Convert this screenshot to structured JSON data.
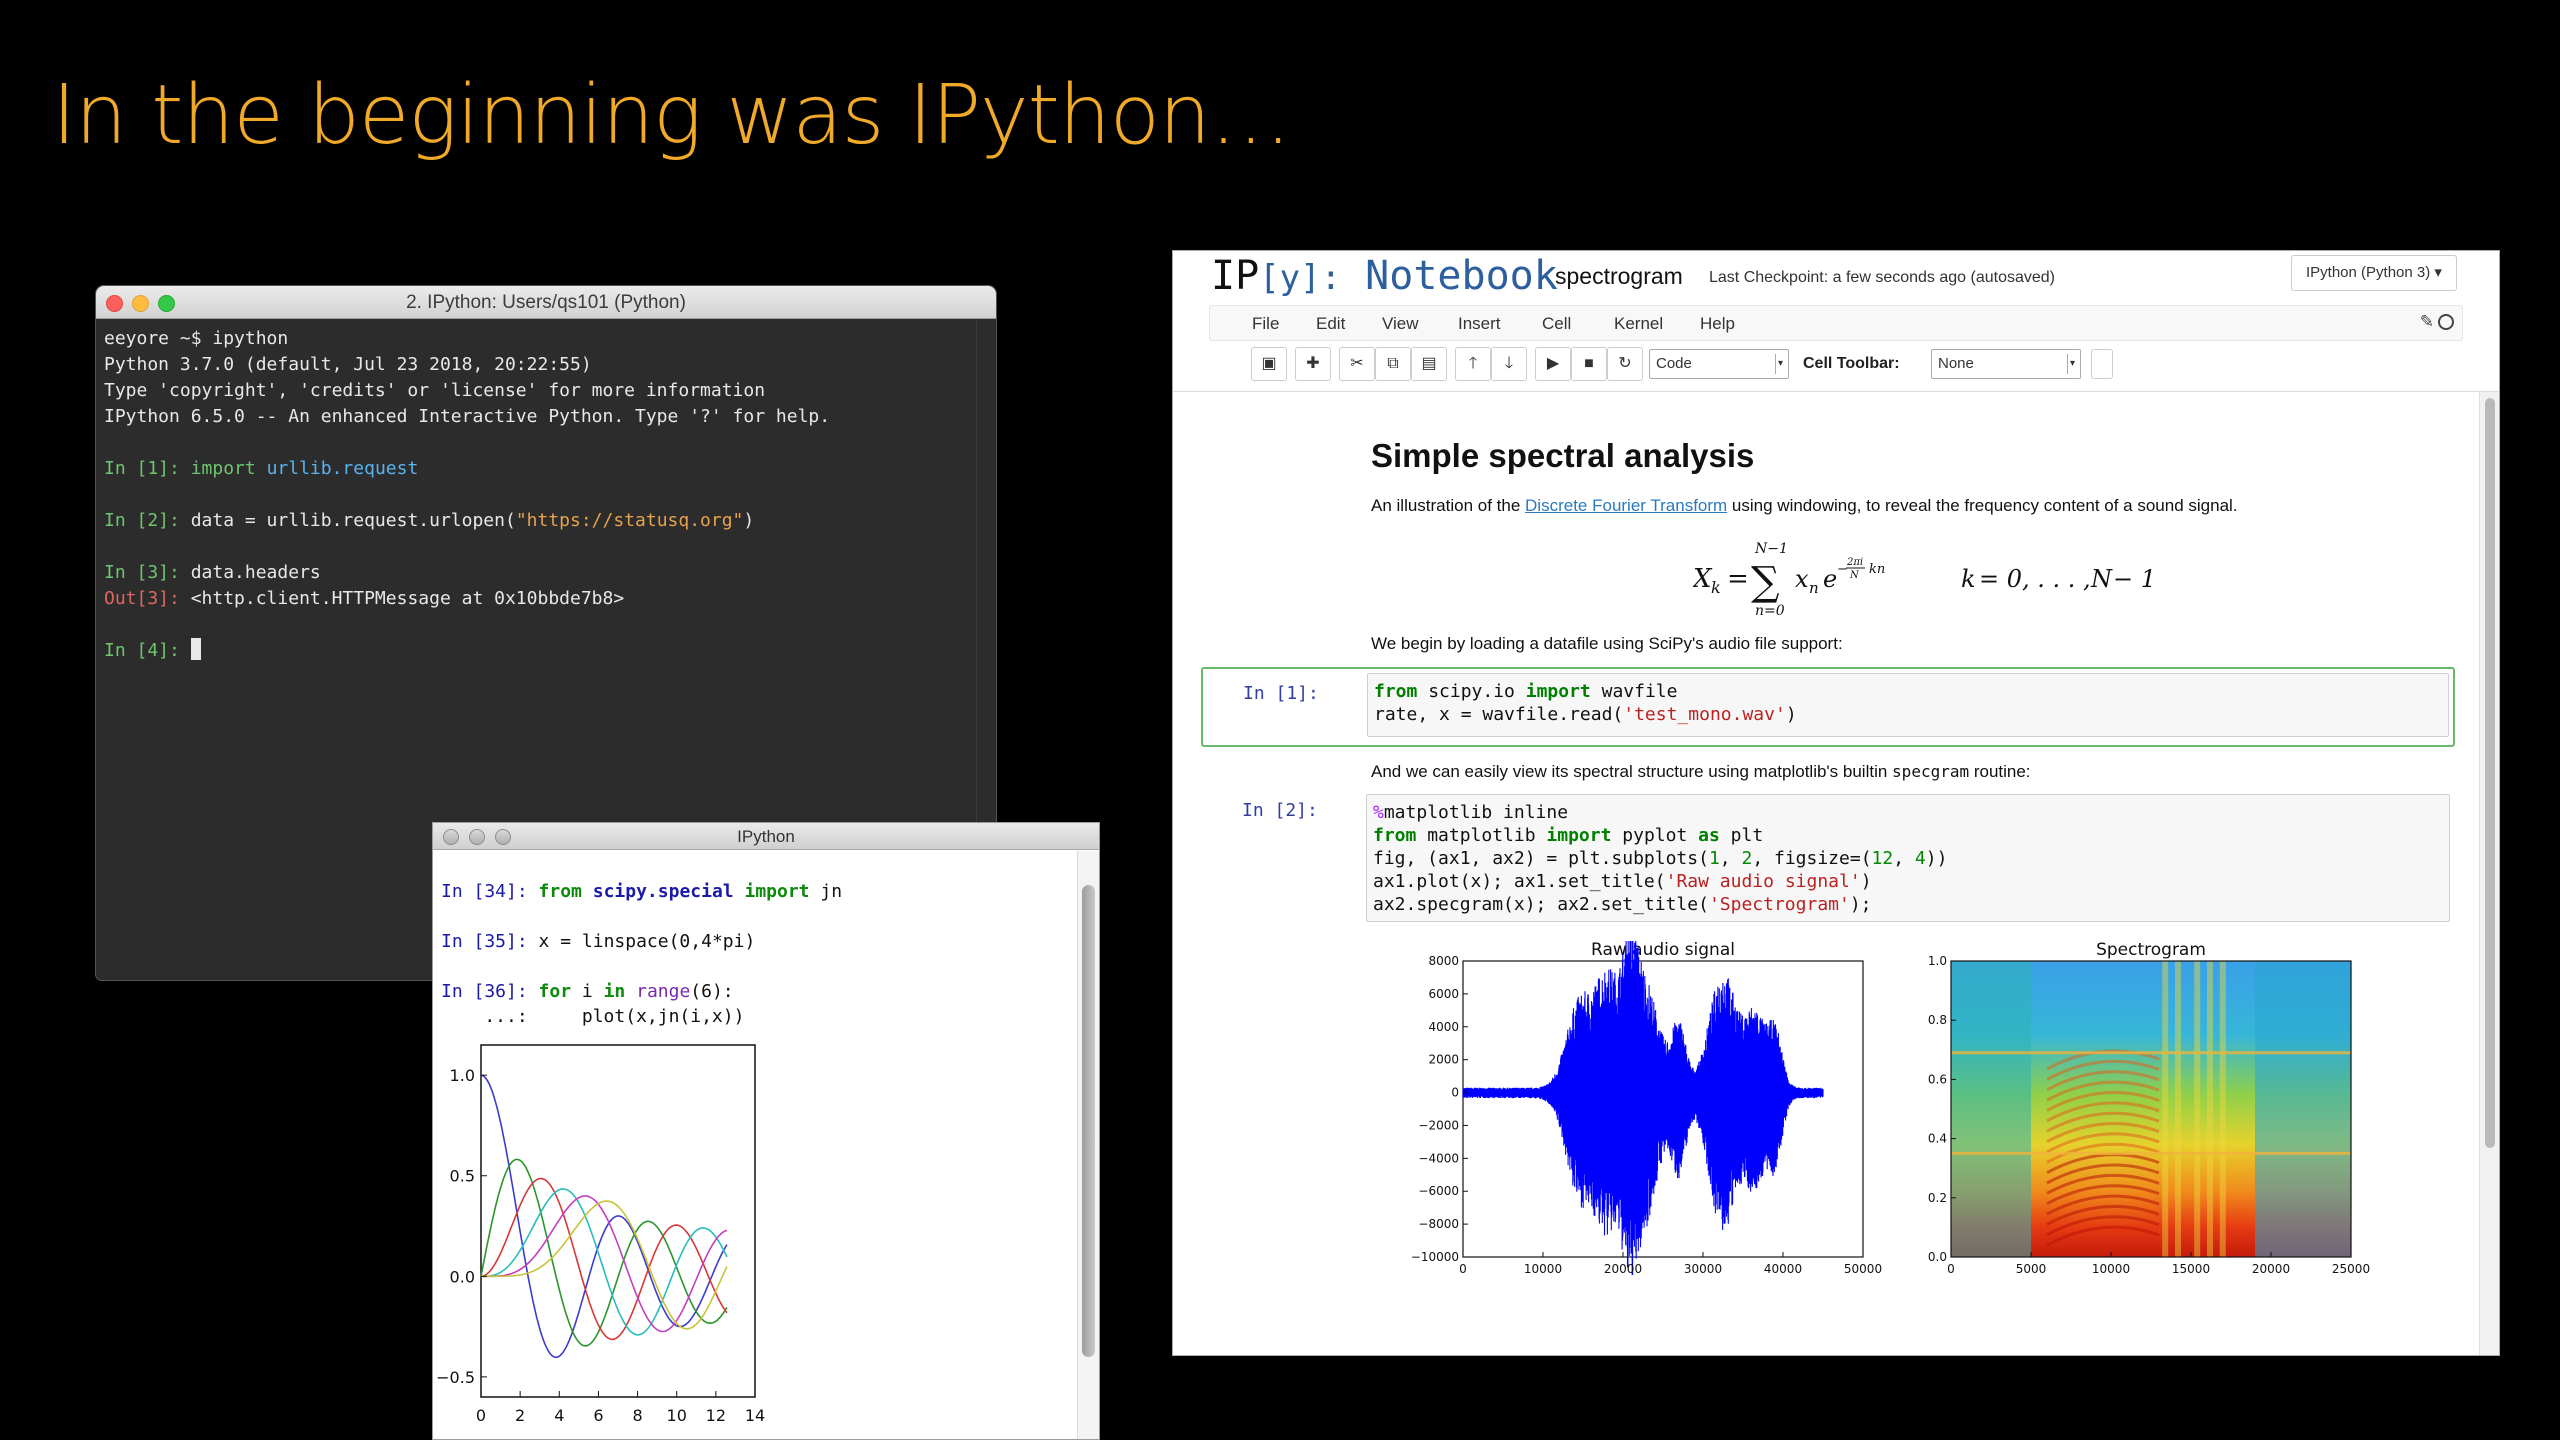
{
  "slide": {
    "title": "In the beginning was IPython…"
  },
  "terminal": {
    "title": "2. IPython: Users/qs101 (Python)",
    "shell_prompt": "eeyore ~$ ipython",
    "banner": [
      "Python 3.7.0 (default, Jul 23 2018, 20:22:55)",
      "Type 'copyright', 'credits' or 'license' for more information",
      "IPython 6.5.0 -- An enhanced Interactive Python. Type '?' for help."
    ],
    "in1_prompt": "In [1]: ",
    "in1_kw": "import",
    "in1_mod": "urllib.request",
    "in2_prompt": "In [2]: ",
    "in2_code": "data = urllib.request.urlopen(",
    "in2_str": "\"https://statusq.org\"",
    "in2_close": ")",
    "in3_prompt": "In [3]: ",
    "in3_code": "data.headers",
    "out3_prompt": "Out[3]: ",
    "out3_value": "<http.client.HTTPMessage at 0x10bbde7b8>",
    "in4_prompt": "In [4]: "
  },
  "qtconsole": {
    "title": "IPython",
    "in34_prompt": "In [34]: ",
    "in34_from": "from",
    "in34_mod": "scipy.special",
    "in34_import": "import",
    "in34_name": "jn",
    "in35_prompt": "In [35]: ",
    "in35_code": "x = linspace(0,4*pi)",
    "in36_prompt": "In [36]: ",
    "in36_for": "for",
    "in36_i": " i ",
    "in36_in": "in",
    "in36_range": "range",
    "in36_rest": "(6):",
    "cont_prompt": "    ...:",
    "cont_code": "     plot(x,jn(i,x))",
    "chart_data": {
      "type": "line",
      "xlim": [
        0,
        14
      ],
      "ylim": [
        -0.6,
        1.15
      ],
      "xticks": [
        "0",
        "2",
        "4",
        "6",
        "8",
        "10",
        "12",
        "14"
      ],
      "yticks": [
        "1.0",
        "0.5",
        "0.0",
        "−0.5"
      ],
      "x_max": 12.566,
      "orders": [
        0,
        1,
        2,
        3,
        4,
        5
      ],
      "colors": [
        "#3c3ccc",
        "#2a962a",
        "#d63838",
        "#29bcbc",
        "#c23fc2",
        "#c9c33a"
      ]
    }
  },
  "notebook": {
    "logo_ip": "IP",
    "logo_y": "[y]:",
    "logo_word": "Notebook",
    "name": "spectrogram",
    "checkpoint": "Last Checkpoint: a few seconds ago (autosaved)",
    "kernel": "IPython (Python 3) ▾",
    "menu": [
      "File",
      "Edit",
      "View",
      "Insert",
      "Cell",
      "Kernel",
      "Help"
    ],
    "toolbar": {
      "cell_type": "Code",
      "cell_toolbar_label": "Cell Toolbar:",
      "cell_toolbar_value": "None"
    },
    "heading": "Simple spectral analysis",
    "intro_pre": "An illustration of the ",
    "intro_link": "Discrete Fourier Transform",
    "intro_post": " using windowing, to reveal the frequency content of a sound signal.",
    "load_text": "We begin by loading a datafile using SciPy's audio file support:",
    "view_pre": "And we can easily view its spectral structure using matplotlib's builtin ",
    "view_code": "specgram",
    "view_post": " routine:",
    "cell1": {
      "prompt": "In [1]:",
      "l1_from": "from",
      "l1_mod": " scipy.io ",
      "l1_import": "import",
      "l1_name": " wavfile",
      "l2_code": "rate, x = wavfile.read(",
      "l2_str": "'test_mono.wav'",
      "l2_close": ")"
    },
    "cell2": {
      "prompt": "In [2]:",
      "l1_magic": "%",
      "l1_code": "matplotlib inline",
      "l2_from": "from",
      "l2_mod": " matplotlib ",
      "l2_import": "import",
      "l2_name": " pyplot ",
      "l2_as": "as",
      "l2_alias": " plt",
      "l3_a": "fig, (ax1, ax2) = plt.subplots(",
      "l3_n1": "1",
      "l3_b": ", ",
      "l3_n2": "2",
      "l3_c": ", figsize=(",
      "l3_n3": "12",
      "l3_d": ", ",
      "l3_n4": "4",
      "l3_e": "))",
      "l4_a": "ax1.plot(x); ax1.set_title(",
      "l4_str": "'Raw audio signal'",
      "l4_b": ")",
      "l5_a": "ax2.specgram(x); ax2.set_title(",
      "l5_str": "'Spectrogram'",
      "l5_b": ");"
    },
    "chart_data": [
      {
        "type": "line",
        "title": "Raw audio signal",
        "xlim": [
          0,
          50000
        ],
        "ylim": [
          -10000,
          8000
        ],
        "xticks": [
          "0",
          "10000",
          "20000",
          "30000",
          "40000",
          "50000"
        ],
        "yticks": [
          "8000",
          "6000",
          "4000",
          "2000",
          "0",
          "−2000",
          "−4000",
          "−6000",
          "−8000",
          "−10000"
        ],
        "color": "#0000ff"
      },
      {
        "type": "heatmap",
        "title": "Spectrogram",
        "xlim": [
          0,
          25000
        ],
        "ylim": [
          0.0,
          1.0
        ],
        "xticks": [
          "0",
          "5000",
          "10000",
          "15000",
          "20000",
          "25000"
        ],
        "yticks": [
          "1.0",
          "0.8",
          "0.6",
          "0.4",
          "0.2",
          "0.0"
        ]
      }
    ]
  }
}
